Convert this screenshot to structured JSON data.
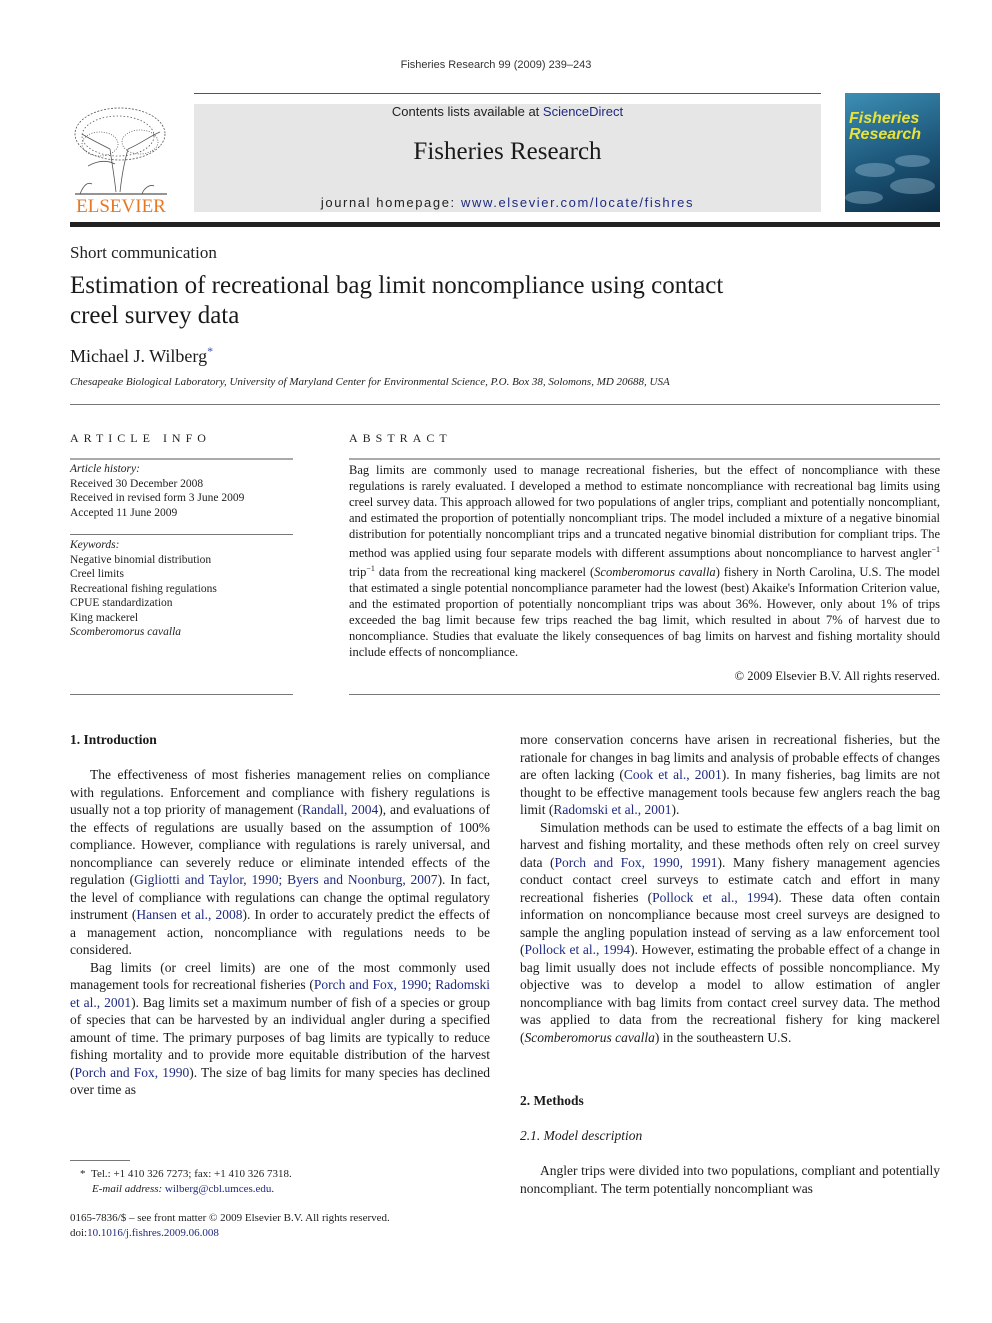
{
  "running_head": "Fisheries Research 99 (2009) 239–243",
  "banner": {
    "contents_prefix": "Contents lists available at ",
    "contents_link": "ScienceDirect",
    "journal_title": "Fisheries Research",
    "homepage_prefix": "journal homepage: ",
    "homepage_link": "www.elsevier.com/locate/fishres"
  },
  "publisher_logo": {
    "text": "ELSEVIER",
    "icon": "elsevier-tree-icon",
    "color": "#e87722"
  },
  "cover": {
    "title_line1": "Fisheries",
    "title_line2": "Research",
    "accent": "#e8e23a"
  },
  "article": {
    "type": "Short communication",
    "title": "Estimation of recreational bag limit noncompliance using contact creel survey data",
    "author": "Michael J. Wilberg",
    "author_mark": "*",
    "affiliation": "Chesapeake Biological Laboratory, University of Maryland Center for Environmental Science, P.O. Box 38, Solomons, MD 20688, USA"
  },
  "article_info": {
    "heading": "ARTICLE INFO",
    "history_label": "Article history:",
    "history": [
      "Received 30 December 2008",
      "Received in revised form 3 June 2009",
      "Accepted 11 June 2009"
    ],
    "keywords_label": "Keywords:",
    "keywords": [
      "Negative binomial distribution",
      "Creel limits",
      "Recreational fishing regulations",
      "CPUE standardization",
      "King mackerel",
      "Scomberomorus cavalla"
    ]
  },
  "abstract": {
    "heading": "ABSTRACT",
    "part1": "Bag limits are commonly used to manage recreational fisheries, but the effect of noncompliance with these regulations is rarely evaluated. I developed a method to estimate noncompliance with recreational bag limits using creel survey data. This approach allowed for two populations of angler trips, compliant and potentially noncompliant, and estimated the proportion of potentially noncompliant trips. The model included a mixture of a negative binomial distribution for potentially noncompliant trips and a truncated negative binomial distribution for compliant trips. The method was applied using four separate models with different assumptions about noncompliance to harvest angler",
    "sup1": "−1",
    "part2": " trip",
    "sup2": "−1",
    "part3": " data from the recreational king mackerel (",
    "species": "Scomberomorus cavalla",
    "part4": ") fishery in North Carolina, U.S. The model that estimated a single potential noncompliance parameter had the lowest (best) Akaike's Information Criterion value, and the estimated proportion of potentially noncompliant trips was about 36%. However, only about 1% of trips exceeded the bag limit because few trips reached the bag limit, which resulted in about 7% of harvest due to noncompliance. Studies that evaluate the likely consequences of bag limits on harvest and fishing mortality should include effects of noncompliance.",
    "copyright": "© 2009 Elsevier B.V. All rights reserved."
  },
  "body": {
    "intro_heading": "1.  Introduction",
    "p1": [
      "The effectiveness of most fisheries management relies on compliance with regulations. Enforcement and compliance with fishery regulations is usually not a top priority of management (",
      "Randall, 2004",
      "), and evaluations of the effects of regulations are usually based on the assumption of 100% compliance. However, compliance with regulations is rarely universal, and noncompliance can severely reduce or eliminate intended effects of the regulation (",
      "Gigliotti and Taylor, 1990; Byers and Noonburg, 2007",
      "). In fact, the level of compliance with regulations can change the optimal regulatory instrument (",
      "Hansen et al., 2008",
      "). In order to accurately predict the effects of a management action, noncompliance with regulations needs to be considered."
    ],
    "p2": [
      "Bag limits (or creel limits) are one of the most commonly used management tools for recreational fisheries (",
      "Porch and Fox, 1990; Radomski et al., 2001",
      "). Bag limits set a maximum number of fish of a species or group of species that can be harvested by an individual angler during a specified amount of time. The primary purposes of bag limits are typically to reduce fishing mortality and to provide more equitable distribution of the harvest (",
      "Porch and Fox, 1990",
      "). The size of bag limits for many species has declined over time as"
    ],
    "p3": [
      "more conservation concerns have arisen in recreational fisheries, but the rationale for changes in bag limits and analysis of probable effects of changes are often lacking (",
      "Cook et al., 2001",
      "). In many fisheries, bag limits are not thought to be effective management tools because few anglers reach the bag limit (",
      "Radomski et al., 2001",
      ")."
    ],
    "p4": [
      "Simulation methods can be used to estimate the effects of a bag limit on harvest and fishing mortality, and these methods often rely on creel survey data (",
      "Porch and Fox, 1990, 1991",
      "). Many fishery management agencies conduct contact creel surveys to estimate catch and effort in many recreational fisheries (",
      "Pollock et al., 1994",
      "). These data often contain information on noncompliance because most creel surveys are designed to sample the angling population instead of serving as a law enforcement tool (",
      "Pollock et al., 1994",
      "). However, estimating the probable effect of a change in bag limit usually does not include effects of possible noncompliance. My objective was to develop a model to allow estimation of angler noncompliance with bag limits from contact creel survey data. The method was applied to data from the recreational fishery for king mackerel (",
      "Scomberomorus cavalla",
      ") in the southeastern U.S."
    ],
    "methods_heading": "2.  Methods",
    "subsection": "2.1.  Model description",
    "p5": "Angler trips were divided into two populations, compliant and potentially noncompliant. The term potentially noncompliant was"
  },
  "footnotes": {
    "mark": "*",
    "contact": "Tel.: +1 410 326 7273; fax: +1 410 326 7318.",
    "email_label": "E-mail address:",
    "email": "wilberg@cbl.umces.edu",
    "front_matter": "0165-7836/$ – see front matter © 2009 Elsevier B.V. All rights reserved.",
    "doi_label": "doi:",
    "doi": "10.1016/j.fishres.2009.06.008"
  }
}
